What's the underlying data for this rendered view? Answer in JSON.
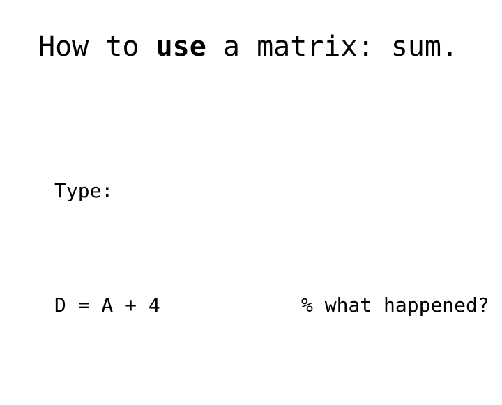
{
  "slide": {
    "background_color": "#ffffff",
    "text_color": "#000000",
    "title": {
      "before_emphasis": "How to ",
      "emphasis": "use",
      "after_emphasis": " a matrix: sum."
    },
    "body": {
      "prompt_label": "Type:",
      "code_line": "D = A + 4",
      "gap": "            ",
      "comment": "% what happened?"
    }
  }
}
